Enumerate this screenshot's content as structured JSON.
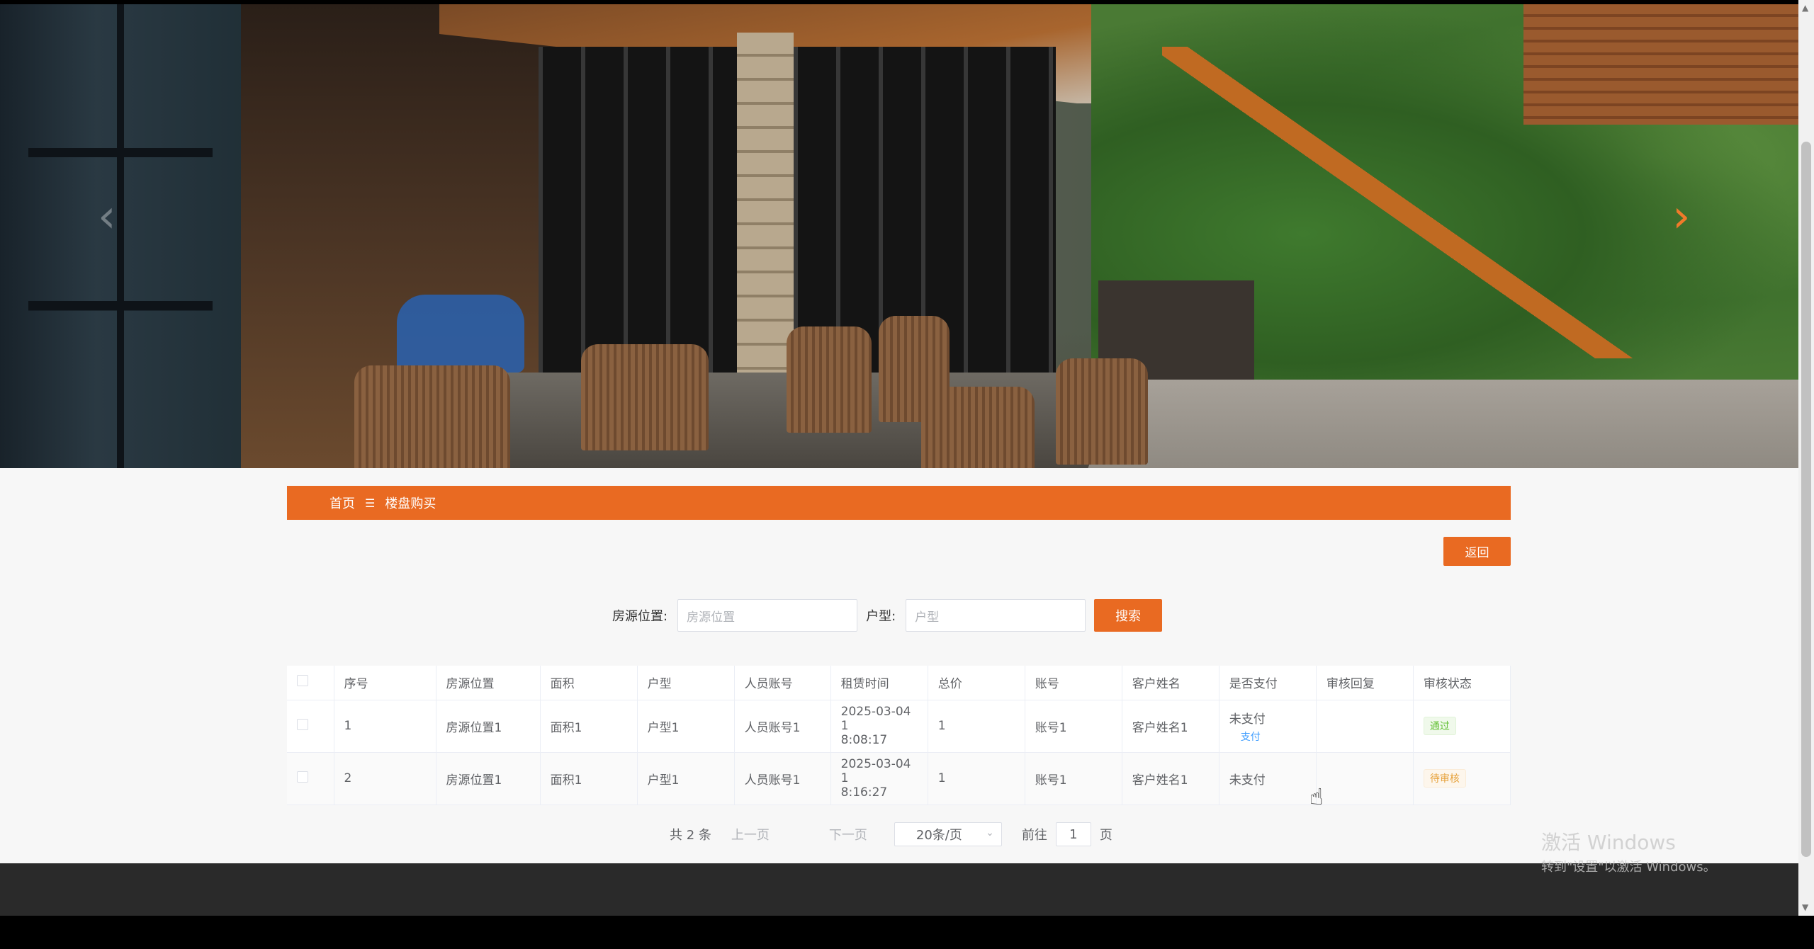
{
  "hero": {
    "prev_arrow": "‹",
    "next_arrow": "›"
  },
  "breadcrumb": {
    "home": "首页",
    "separator": "☰",
    "current": "楼盘购买"
  },
  "back_button": "返回",
  "search": {
    "location_label": "房源位置:",
    "location_placeholder": "房源位置",
    "type_label": "户型:",
    "type_placeholder": "户型",
    "button": "搜索"
  },
  "table": {
    "headers": [
      "序号",
      "房源位置",
      "面积",
      "户型",
      "人员账号",
      "租赁时间",
      "总价",
      "账号",
      "客户姓名",
      "是否支付",
      "审核回复",
      "审核状态"
    ],
    "rows": [
      {
        "index": "1",
        "location": "房源位置1",
        "area": "面积1",
        "type": "户型1",
        "staff": "人员账号1",
        "time_line1": "2025-03-04 1",
        "time_line2": "8:08:17",
        "price": "1",
        "account": "账号1",
        "customer": "客户姓名1",
        "paid": "未支付",
        "pay_link": "支付",
        "reply": "",
        "status": "通过"
      },
      {
        "index": "2",
        "location": "房源位置1",
        "area": "面积1",
        "type": "户型1",
        "staff": "人员账号1",
        "time_line1": "2025-03-04 1",
        "time_line2": "8:16:27",
        "price": "1",
        "account": "账号1",
        "customer": "客户姓名1",
        "paid": "未支付",
        "pay_link": "",
        "reply": "",
        "status": "待审核"
      }
    ]
  },
  "pagination": {
    "total": "共 2 条",
    "prev": "上一页",
    "next": "下一页",
    "page_size": "20条/页",
    "goto_label": "前往",
    "goto_value": "1",
    "page_suffix": "页"
  },
  "watermark": {
    "line1": "激活 Windows",
    "line2": "转到\"设置\"以激活 Windows。"
  },
  "colors": {
    "accent": "#e96a22",
    "link": "#409eff",
    "success": "#67c23a",
    "warning": "#e6a23c"
  }
}
